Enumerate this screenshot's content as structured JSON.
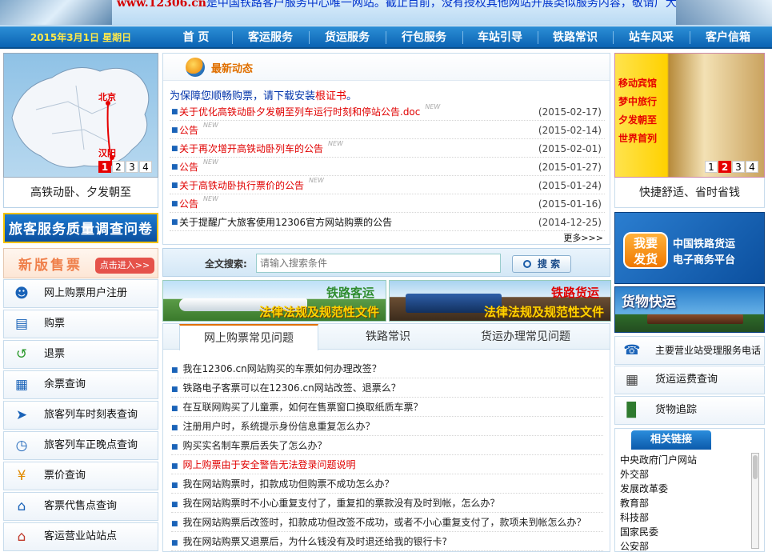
{
  "banner": {
    "domain": "www.12306.cn",
    "text": "是中国铁路客户服务中心唯一网站。截止目前，没有授权其他网站开展类似服务内容，敬请广大用户注意"
  },
  "nav": {
    "date": "2015年3月1日 星期日",
    "items": [
      "首 页",
      "客运服务",
      "货运服务",
      "行包服务",
      "车站引导",
      "铁路常识",
      "站车风采",
      "客户信箱"
    ]
  },
  "left": {
    "map_labels": [
      "北京",
      "汉阳"
    ],
    "pager": [
      "1",
      "2",
      "3",
      "4"
    ],
    "caption": "高铁动卧、夕发朝至",
    "survey": "旅客服务质量调查问卷",
    "newver_title": "新版售票",
    "newver_btn": "点击进入>>",
    "items": [
      {
        "label": "网上购票用户注册",
        "icon": "user-register-icon"
      },
      {
        "label": "购票",
        "icon": "ticket-icon"
      },
      {
        "label": "退票",
        "icon": "refund-icon"
      },
      {
        "label": "余票查询",
        "icon": "remaining-ticket-icon"
      },
      {
        "label": "旅客列车时刻表查询",
        "icon": "train-schedule-icon"
      },
      {
        "label": "旅客列车正晚点查询",
        "icon": "clock-icon"
      },
      {
        "label": "票价查询",
        "icon": "price-icon"
      },
      {
        "label": "客票代售点查询",
        "icon": "agency-icon"
      },
      {
        "label": "客运营业站站点",
        "icon": "station-icon"
      }
    ]
  },
  "news": {
    "title": "最新动态",
    "notice_pre": "为保障您顺畅购票，请下载安装",
    "notice_link": "根证书",
    "notice_post": "。",
    "new_tag": "NEW",
    "items": [
      {
        "text": "关于优化高铁动卧夕发朝至列车运行时刻和停站公告.doc",
        "date": "(2015-02-17)",
        "new": true,
        "red": true
      },
      {
        "text": "公告",
        "date": "(2015-02-14)",
        "new": true,
        "red": true
      },
      {
        "text": "关于再次增开高铁动卧列车的公告",
        "date": "(2015-02-01)",
        "new": true,
        "red": true
      },
      {
        "text": "公告",
        "date": "(2015-01-27)",
        "new": true,
        "red": true
      },
      {
        "text": "关于高铁动卧执行票价的公告",
        "date": "(2015-01-24)",
        "new": true,
        "red": true
      },
      {
        "text": "公告",
        "date": "(2015-01-16)",
        "new": true,
        "red": true
      },
      {
        "text": "关于提醒广大旅客使用12306官方网站购票的公告",
        "date": "(2014-12-25)",
        "new": false,
        "red": false
      }
    ],
    "more": "更多>>>"
  },
  "search": {
    "label": "全文搜索:",
    "placeholder": "请输入搜索条件",
    "button": "搜 索"
  },
  "laws": [
    {
      "t1": "铁路客运",
      "t2": "法律法规及规范性文件"
    },
    {
      "t1": "铁路货运",
      "t2": "法律法规及规范性文件"
    }
  ],
  "faq": {
    "tabs": [
      "网上购票常见问题",
      "铁路常识",
      "货运办理常见问题"
    ],
    "items": [
      {
        "text": "我在12306.cn网站购买的车票如何办理改签？",
        "red": false
      },
      {
        "text": "铁路电子客票可以在12306.cn网站改签、退票么？",
        "red": false
      },
      {
        "text": "在互联网购买了儿童票，如何在售票窗口换取纸质车票？",
        "red": false
      },
      {
        "text": "注册用户时，系统提示身份信息重复怎么办？",
        "red": false
      },
      {
        "text": "购买实名制车票后丢失了怎么办？",
        "red": false
      },
      {
        "text": "网上购票由于安全警告无法登录问题说明",
        "red": true
      },
      {
        "text": "我在网站购票时，扣款成功但购票不成功怎么办？",
        "red": false
      },
      {
        "text": "我在网站购票时不小心重复支付了，重复扣的票款没有及时到帐，怎么办？",
        "red": false
      },
      {
        "text": "我在网站购票后改签时，扣款成功但改签不成功，或者不小心重复支付了，款项未到帐怎么办？",
        "red": false
      },
      {
        "text": "我在网站购票又退票后，为什么钱没有及时退还给我的银行卡?",
        "red": false
      }
    ]
  },
  "right": {
    "ad_lines": [
      "移动宾馆",
      "梦中旅行",
      "夕发朝至",
      "世界首列"
    ],
    "pager": [
      "1",
      "2",
      "3",
      "4"
    ],
    "caption": "快捷舒适、省时省钱",
    "fp_badge_1": "我要",
    "fp_badge_2": "发货",
    "fp_text_1": "中国铁路货运",
    "fp_text_2": "电子商务平台",
    "express": "货物快运",
    "items": [
      {
        "label": "主要营业站受理服务电话",
        "icon": "phone-icon"
      },
      {
        "label": "货运运费查询",
        "icon": "calculator-icon"
      },
      {
        "label": "货物追踪",
        "icon": "freight-train-icon"
      }
    ],
    "links_title": "相关链接",
    "links": [
      "中央政府门户网站",
      "外交部",
      "发展改革委",
      "教育部",
      "科技部",
      "国家民委",
      "公安部"
    ]
  }
}
